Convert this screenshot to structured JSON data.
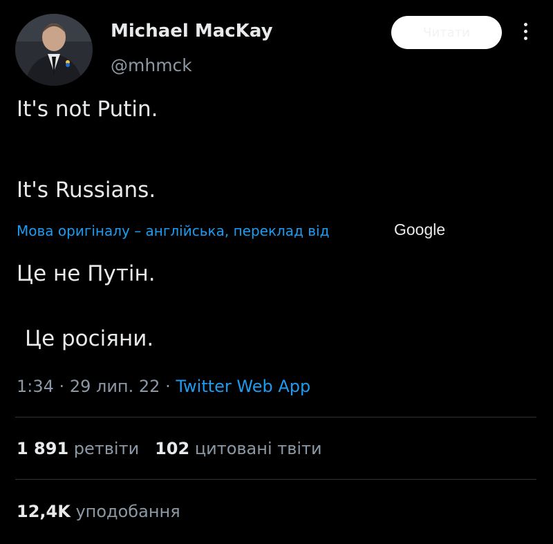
{
  "author": {
    "name": "Michael MacKay",
    "handle": "@mhmck"
  },
  "follow_button": {
    "label": "Читати"
  },
  "tweet": {
    "lines": [
      "It's not Putin.",
      "It's Russians."
    ]
  },
  "translation": {
    "notice": "Мова оригіналу – англійська, переклад від",
    "provider": "Google",
    "lines": [
      "Це не Путін.",
      "Це росіяни."
    ]
  },
  "meta": {
    "time": "1:34",
    "date": "29 лип. 22",
    "separator": "·",
    "source": "Twitter Web App"
  },
  "stats": {
    "retweets_count": "1 891",
    "retweets_label": "ретвіти",
    "quotes_count": "102",
    "quotes_label": "цитовані твіти",
    "likes_count": "12,4K",
    "likes_label": "уподобання"
  },
  "colors": {
    "background": "#000000",
    "text": "#e7e9ea",
    "secondary": "#8b98a5",
    "link": "#1d9bf0"
  }
}
